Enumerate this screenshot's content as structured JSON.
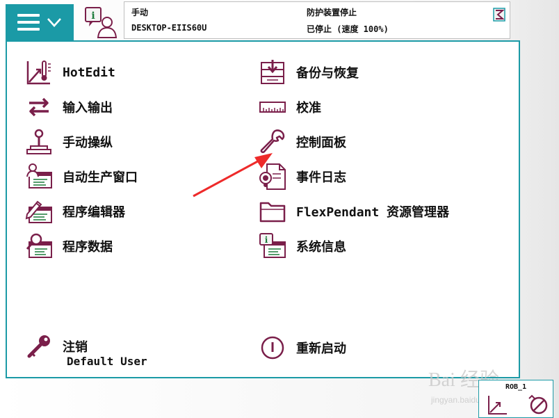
{
  "header": {
    "mode": "手动",
    "hostname": "DESKTOP-EIIS60U",
    "safety": "防护装置停止",
    "state": "已停止 (速度 100%)"
  },
  "menu": {
    "left": [
      {
        "label": "HotEdit",
        "icon": "hotedit-icon"
      },
      {
        "label": "输入输出",
        "icon": "io-arrows-icon"
      },
      {
        "label": "手动操纵",
        "icon": "joystick-icon"
      },
      {
        "label": "自动生产窗口",
        "icon": "auto-production-icon"
      },
      {
        "label": "程序编辑器",
        "icon": "program-editor-icon"
      },
      {
        "label": "程序数据",
        "icon": "program-data-icon"
      }
    ],
    "right": [
      {
        "label": "备份与恢复",
        "icon": "backup-icon"
      },
      {
        "label": "校准",
        "icon": "calibration-icon"
      },
      {
        "label": "控制面板",
        "icon": "wrench-icon"
      },
      {
        "label": "事件日志",
        "icon": "event-log-icon"
      },
      {
        "label": "FlexPendant 资源管理器",
        "icon": "folder-icon"
      },
      {
        "label": "系统信息",
        "icon": "system-info-icon"
      }
    ],
    "logout": {
      "label": "注销",
      "user": "Default User",
      "icon": "key-icon"
    },
    "restart": {
      "label": "重新启动",
      "icon": "power-icon"
    }
  },
  "robot": {
    "unit": "ROB_1"
  },
  "watermark": {
    "brand": "Bai 经验",
    "url": "jingyan.baidu.com"
  },
  "colors": {
    "accent": "#1b9aa6",
    "icon": "#7a1f4a",
    "annotation": "#ee2a2a"
  }
}
